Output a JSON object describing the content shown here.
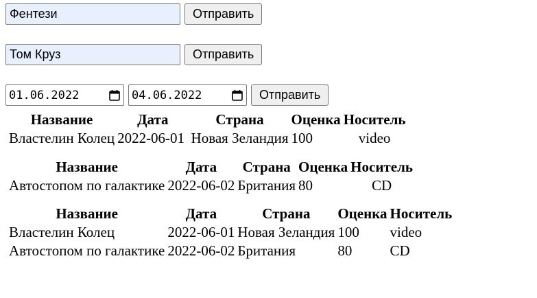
{
  "genre_form": {
    "value": "Фентези",
    "submit_label": "Отправить"
  },
  "actor_form": {
    "value": "Том Круз",
    "submit_label": "Отправить"
  },
  "date_form": {
    "start": "01.06.2022",
    "end": "04.06.2022",
    "submit_label": "Отправить"
  },
  "table_headers": [
    "Название",
    "Дата",
    "Страна",
    "Оценка",
    "Носитель"
  ],
  "table1": {
    "rows": [
      [
        "Властелин Колец",
        "2022-06-01",
        "Новая Зеландия",
        "100",
        "video"
      ]
    ]
  },
  "table2": {
    "rows": [
      [
        "Автостопом по галактике",
        "2022-06-02",
        "Британия",
        "80",
        "CD"
      ]
    ]
  },
  "table3": {
    "rows": [
      [
        "Властелин Колец",
        "2022-06-01",
        "Новая Зеландия",
        "100",
        "video"
      ],
      [
        "Автостопом по галактике",
        "2022-06-02",
        "Британия",
        "80",
        "CD"
      ]
    ]
  }
}
